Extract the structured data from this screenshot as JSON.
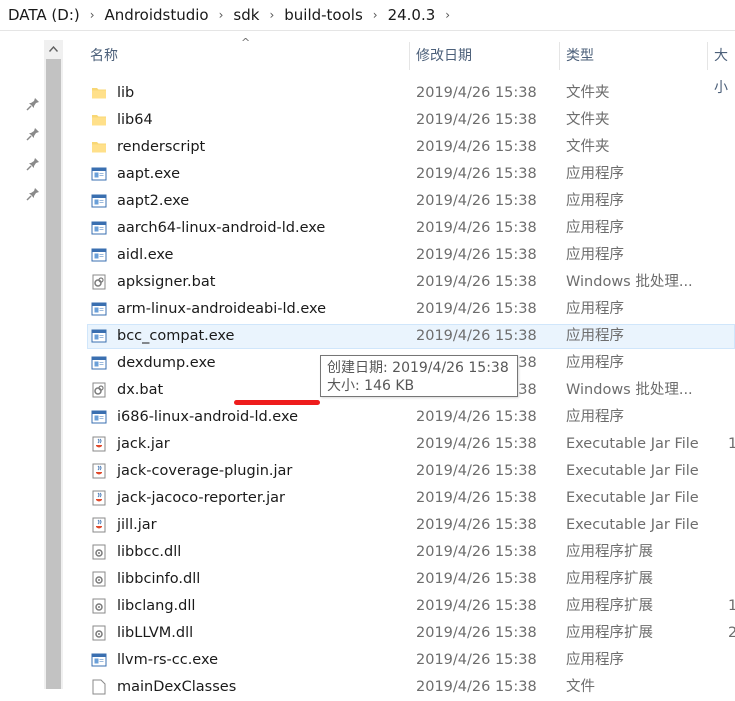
{
  "breadcrumb": [
    "DATA (D:)",
    "Androidstudio",
    "sdk",
    "build-tools",
    "24.0.3"
  ],
  "columns": {
    "name": "名称",
    "date": "修改日期",
    "type": "类型",
    "size": "大小"
  },
  "files": [
    {
      "name": "lib",
      "date": "2019/4/26 15:38",
      "type": "文件夹",
      "icon": "folder-icon",
      "size": ""
    },
    {
      "name": "lib64",
      "date": "2019/4/26 15:38",
      "type": "文件夹",
      "icon": "folder-icon",
      "size": ""
    },
    {
      "name": "renderscript",
      "date": "2019/4/26 15:38",
      "type": "文件夹",
      "icon": "folder-icon",
      "size": ""
    },
    {
      "name": "aapt.exe",
      "date": "2019/4/26 15:38",
      "type": "应用程序",
      "icon": "exe-icon",
      "size": ""
    },
    {
      "name": "aapt2.exe",
      "date": "2019/4/26 15:38",
      "type": "应用程序",
      "icon": "exe-icon",
      "size": ""
    },
    {
      "name": "aarch64-linux-android-ld.exe",
      "date": "2019/4/26 15:38",
      "type": "应用程序",
      "icon": "exe-icon",
      "size": ""
    },
    {
      "name": "aidl.exe",
      "date": "2019/4/26 15:38",
      "type": "应用程序",
      "icon": "exe-icon",
      "size": ""
    },
    {
      "name": "apksigner.bat",
      "date": "2019/4/26 15:38",
      "type": "Windows 批处理...",
      "icon": "bat-icon",
      "size": ""
    },
    {
      "name": "arm-linux-androideabi-ld.exe",
      "date": "2019/4/26 15:38",
      "type": "应用程序",
      "icon": "exe-icon",
      "size": ""
    },
    {
      "name": "bcc_compat.exe",
      "date": "2019/4/26 15:38",
      "type": "应用程序",
      "icon": "exe-icon",
      "size": ""
    },
    {
      "name": "dexdump.exe",
      "date": "2019/4/26 15:38",
      "type": "应用程序",
      "icon": "exe-icon",
      "size": ""
    },
    {
      "name": "dx.bat",
      "date": "2019/4/26 15:38",
      "type": "Windows 批处理...",
      "icon": "bat-icon",
      "size": ""
    },
    {
      "name": "i686-linux-android-ld.exe",
      "date": "2019/4/26 15:38",
      "type": "应用程序",
      "icon": "exe-icon",
      "size": ""
    },
    {
      "name": "jack.jar",
      "date": "2019/4/26 15:38",
      "type": "Executable Jar File",
      "icon": "jar-icon",
      "size": "1"
    },
    {
      "name": "jack-coverage-plugin.jar",
      "date": "2019/4/26 15:38",
      "type": "Executable Jar File",
      "icon": "jar-icon",
      "size": ""
    },
    {
      "name": "jack-jacoco-reporter.jar",
      "date": "2019/4/26 15:38",
      "type": "Executable Jar File",
      "icon": "jar-icon",
      "size": ""
    },
    {
      "name": "jill.jar",
      "date": "2019/4/26 15:38",
      "type": "Executable Jar File",
      "icon": "jar-icon",
      "size": ""
    },
    {
      "name": "libbcc.dll",
      "date": "2019/4/26 15:38",
      "type": "应用程序扩展",
      "icon": "dll-icon",
      "size": ""
    },
    {
      "name": "libbcinfo.dll",
      "date": "2019/4/26 15:38",
      "type": "应用程序扩展",
      "icon": "dll-icon",
      "size": ""
    },
    {
      "name": "libclang.dll",
      "date": "2019/4/26 15:38",
      "type": "应用程序扩展",
      "icon": "dll-icon",
      "size": "1"
    },
    {
      "name": "libLLVM.dll",
      "date": "2019/4/26 15:38",
      "type": "应用程序扩展",
      "icon": "dll-icon",
      "size": "2"
    },
    {
      "name": "llvm-rs-cc.exe",
      "date": "2019/4/26 15:38",
      "type": "应用程序",
      "icon": "exe-icon",
      "size": ""
    },
    {
      "name": "mainDexClasses",
      "date": "2019/4/26 15:38",
      "type": "文件",
      "icon": "file-icon",
      "size": ""
    }
  ],
  "hovered_row": "bcc_compat.exe",
  "tooltip": {
    "created": "创建日期: 2019/4/26 15:38",
    "size": "大小: 146 KB"
  },
  "colors": {
    "hover_background": "#eaf4fd",
    "header_text": "#4c607a",
    "annotation_line": "#ee1c1c",
    "folder": "#f8d775"
  }
}
